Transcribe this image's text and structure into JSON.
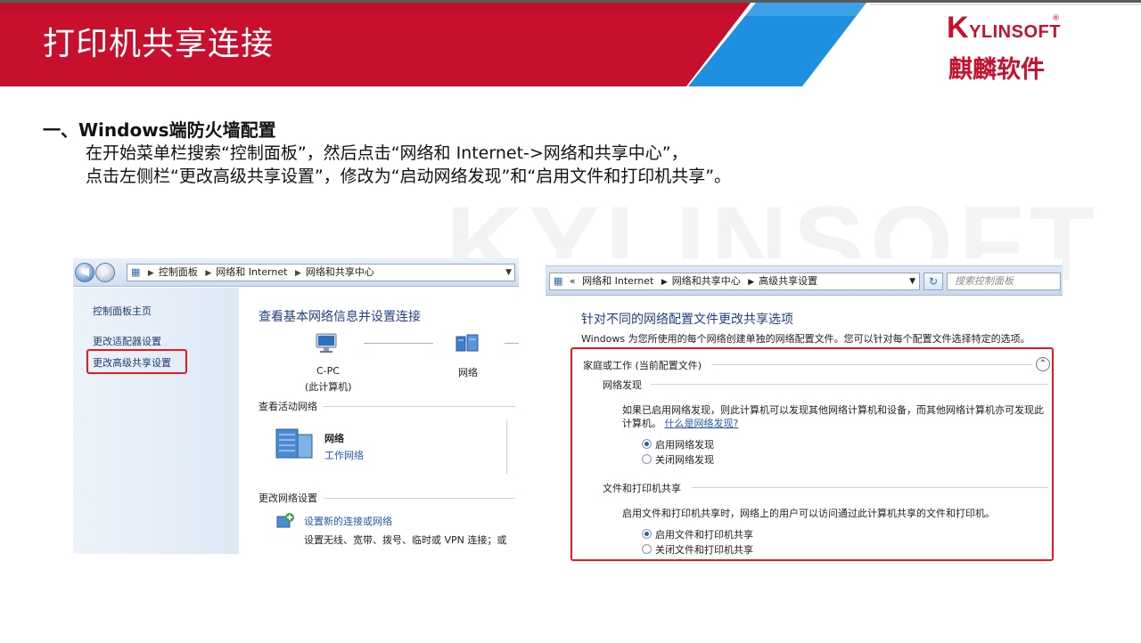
{
  "header": {
    "title": "打印机共享连接",
    "logo_text_k": "K",
    "logo_text_rest": "YLINSOFT",
    "logo_reg": "®",
    "logo_cn": "麒麟软件",
    "watermark": "KYLINSOFT"
  },
  "section": {
    "heading": "一、Windows端防火墙配置",
    "line1": "在开始菜单栏搜索“控制面板”，然后点击“网络和 Internet->网络和共享中心”，",
    "line2": "点击左侧栏“更改高级共享设置”，修改为“启动网络发现”和“启用文件和打印机共享”。"
  },
  "shot1": {
    "breadcrumb": [
      "控制面板",
      "网络和 Internet",
      "网络和共享中心"
    ],
    "left_items": [
      "控制面板主页",
      "更改适配器设置",
      "更改高级共享设置"
    ],
    "main_title": "查看基本网络信息并设置连接",
    "pc_name": "C-PC",
    "pc_sub": "(此计算机)",
    "network_label": "网络",
    "active_networks": "查看活动网络",
    "network_name": "网络",
    "network_type": "工作网络",
    "change_settings": "更改网络设置",
    "setup_link": "设置新的连接或网络",
    "setup_desc": "设置无线、宽带、拨号、临时或 VPN 连接；或"
  },
  "shot2": {
    "breadcrumb_prefix": "«",
    "breadcrumb": [
      "网络和 Internet",
      "网络和共享中心",
      "高级共享设置"
    ],
    "search_placeholder": "搜索控制面板",
    "title": "针对不同的网络配置文件更改共享选项",
    "desc": "Windows 为您所使用的每个网络创建单独的网络配置文件。您可以针对每个配置文件选择特定的选项。",
    "profile": "家庭或工作 (当前配置文件)",
    "discovery_heading": "网络发现",
    "discovery_desc1": "如果已启用网络发现，则此计算机可以发现其他网络计算机和设备，而其他网络计算机亦可发现此",
    "discovery_desc2": "计算机。",
    "discovery_link": "什么是网络发现?",
    "discovery_on": "启用网络发现",
    "discovery_off": "关闭网络发现",
    "sharing_heading": "文件和打印机共享",
    "sharing_desc": "启用文件和打印机共享时，网络上的用户可以访问通过此计算机共享的文件和打印机。",
    "sharing_on": "启用文件和打印机共享",
    "sharing_off": "关闭文件和打印机共享"
  },
  "colors": {
    "banner_red": "#c8102e",
    "banner_blue": "#1f8fe0",
    "highlight_red": "#e21b23",
    "link_blue": "#1f58b8"
  }
}
